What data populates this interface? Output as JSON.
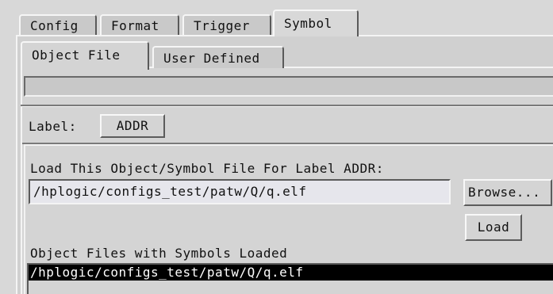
{
  "tabs": [
    {
      "label": "Config"
    },
    {
      "label": "Format"
    },
    {
      "label": "Trigger"
    },
    {
      "label": "Symbol",
      "active": true
    }
  ],
  "subtabs": [
    {
      "label": "Object File",
      "active": true
    },
    {
      "label": "User Defined"
    }
  ],
  "label_row": {
    "caption": "Label:",
    "value": "ADDR"
  },
  "load_section": {
    "heading": "Load This Object/Symbol File For Label ADDR:",
    "file_path": "/hplogic/configs_test/patw/Q/q.elf",
    "browse_label": "Browse...",
    "load_label": "Load"
  },
  "loaded_section": {
    "heading": "Object Files with Symbols Loaded",
    "items": [
      "/hplogic/configs_test/patw/Q/q.elf"
    ]
  }
}
